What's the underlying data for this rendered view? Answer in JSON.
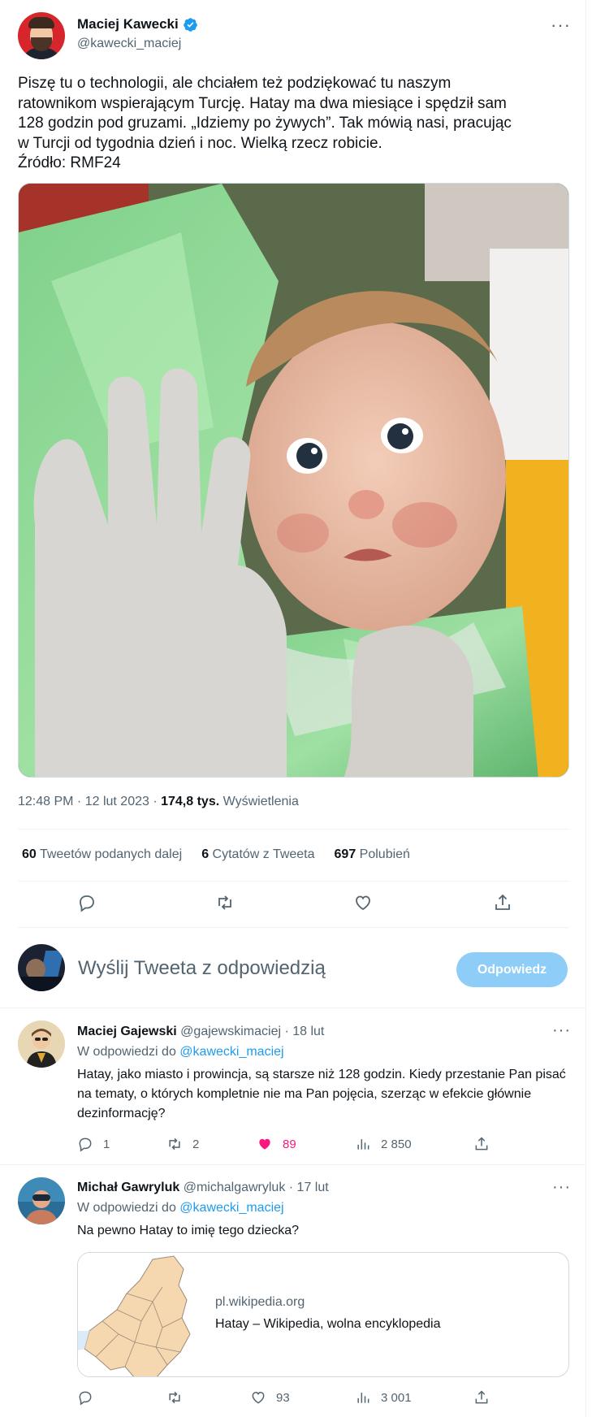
{
  "tweet": {
    "author_name": "Maciej Kawecki",
    "author_handle": "@kawecki_maciej",
    "more": "···",
    "text": "Piszę tu o technologii, ale chciałem też podziękować tu naszym\nratownikom wspierającym Turcję. Hatay ma dwa miesiące i spędził sam\n128 godzin pod gruzami. „Idziemy po żywych”. Tak mówią nasi, pracując\nw Turcji od tygodnia dzień i noc. Wielką rzecz robicie.\nŹródło: RMF24",
    "time": "12:48 PM · 12 lut 2023 · ",
    "views_count": "174,8 tys.",
    "views_label": " Wyświetlenia",
    "stats": {
      "retweets_count": "60",
      "retweets_label": " Tweetów podanych dalej",
      "quotes_count": "6",
      "quotes_label": " Cytatów z Tweeta",
      "likes_count": "697",
      "likes_label": " Polubień"
    }
  },
  "composer": {
    "placeholder": "Wyślij Tweeta z odpowiedzią",
    "reply_button": "Odpowiedz"
  },
  "replies": [
    {
      "name": "Maciej Gajewski",
      "handle_time": " @gajewskimaciej · 18 lut",
      "reply_to_prefix": "W odpowiedzi do ",
      "reply_to_handle": "@kawecki_maciej",
      "text": "Hatay, jako miasto i prowincja, są starsze niż 128 godzin. Kiedy przestanie Pan pisać na tematy, o których kompletnie nie ma Pan pojęcia, szerząc w efekcie głównie dezinformację?",
      "replies": "1",
      "retweets": "2",
      "likes": "89",
      "views": "2 850"
    },
    {
      "name": "Michał Gawryluk",
      "handle_time": " @michalgawryluk · 17 lut",
      "reply_to_prefix": "W odpowiedzi do ",
      "reply_to_handle": "@kawecki_maciej",
      "text": "Na pewno Hatay to imię tego dziecka?",
      "replies": "",
      "retweets": "",
      "likes": "93",
      "views": "3 001",
      "card_domain": "pl.wikipedia.org",
      "card_title": "Hatay – Wikipedia, wolna encyklopedia"
    }
  ],
  "colors": {
    "accent": "#1d9bf0",
    "like_active": "#f91880",
    "reply_button": "#8ecdf8",
    "secondary_text": "#536471"
  }
}
